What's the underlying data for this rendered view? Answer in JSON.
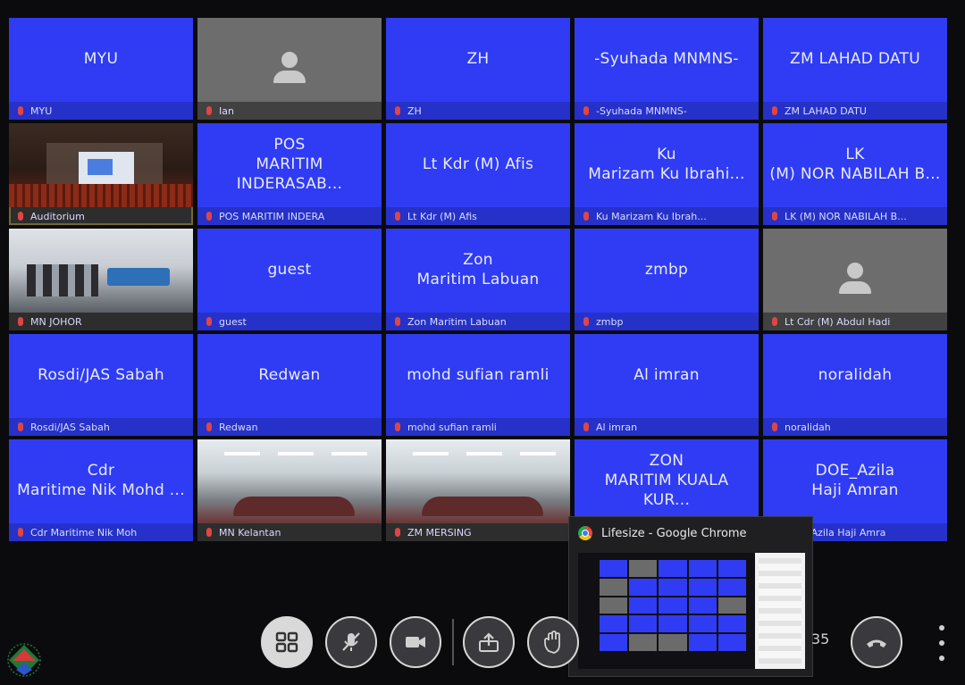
{
  "tiles": [
    {
      "name": "MYU",
      "label": "MYU",
      "type": "name"
    },
    {
      "name": "",
      "label": "Ian",
      "type": "avatar"
    },
    {
      "name": "ZH",
      "label": "ZH",
      "type": "name"
    },
    {
      "name": "-Syuhada MNMNS-",
      "label": "-Syuhada MNMNS-",
      "type": "name"
    },
    {
      "name": "ZM LAHAD DATU",
      "label": "ZM LAHAD DATU",
      "type": "name"
    },
    {
      "name": "",
      "label": "Auditorium",
      "type": "video-auditorium"
    },
    {
      "name": "POS\nMARITIM INDERASAB...",
      "label": "POS MARITIM INDERA",
      "type": "name"
    },
    {
      "name": "Lt Kdr (M) Afis",
      "label": "Lt Kdr (M) Afis",
      "type": "name"
    },
    {
      "name": "Ku\nMarizam Ku Ibrahi...",
      "label": "Ku Marizam Ku Ibrah...",
      "type": "name"
    },
    {
      "name": "LK\n(M) NOR NABILAH B...",
      "label": "LK (M) NOR NABILAH B...",
      "type": "name"
    },
    {
      "name": "",
      "label": "MN JOHOR",
      "type": "video-johor"
    },
    {
      "name": "guest",
      "label": "guest",
      "type": "name"
    },
    {
      "name": "Zon\nMaritim Labuan",
      "label": "Zon Maritim Labuan",
      "type": "name"
    },
    {
      "name": "zmbp",
      "label": "zmbp",
      "type": "name"
    },
    {
      "name": "",
      "label": "Lt Cdr (M) Abdul Hadi",
      "type": "avatar"
    },
    {
      "name": "Rosdi/JAS Sabah",
      "label": "Rosdi/JAS Sabah",
      "type": "name"
    },
    {
      "name": "Redwan",
      "label": "Redwan",
      "type": "name"
    },
    {
      "name": "mohd sufian ramli",
      "label": "mohd sufian ramli",
      "type": "name"
    },
    {
      "name": "Al imran",
      "label": "Al imran",
      "type": "name"
    },
    {
      "name": "noralidah",
      "label": "noralidah",
      "type": "name"
    },
    {
      "name": "Cdr\nMaritime Nik Mohd ...",
      "label": "Cdr Maritime Nik Moh",
      "type": "name"
    },
    {
      "name": "",
      "label": "MN Kelantan",
      "type": "video-room"
    },
    {
      "name": "",
      "label": "ZM MERSING",
      "type": "video-room"
    },
    {
      "name": "ZON\nMARITIM KUALA KUR...",
      "label": "",
      "type": "name"
    },
    {
      "name": "DOE_Azila\nHaji Amran",
      "label": "DOE_Azila Haji Amra",
      "type": "name"
    }
  ],
  "popup": {
    "title": "Lifesize - Google Chrome"
  },
  "controls": {
    "icons": [
      "layout-grid-icon",
      "mic-muted-icon",
      "video-camera-icon",
      "share-screen-icon",
      "raise-hand-icon",
      "hang-up-icon"
    ]
  },
  "call": {
    "timer": "35"
  },
  "colors": {
    "tile": "#2f3cf3",
    "tile_bar": "#2631c9",
    "active_border": "#e3c24a",
    "background": "#0b0b0d"
  }
}
